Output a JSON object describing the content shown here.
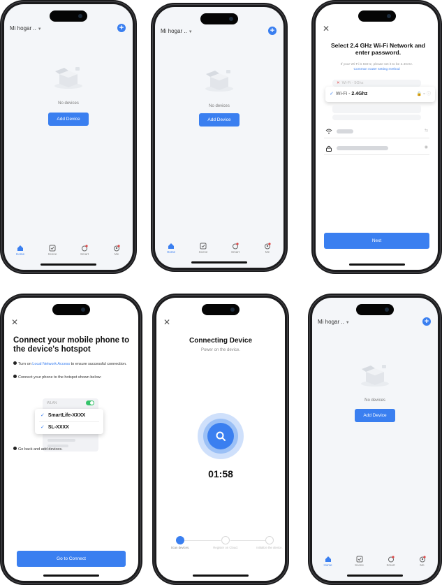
{
  "colors": {
    "accent": "#3a7ff0",
    "toggle_on": "#35c36a",
    "error": "#e04848"
  },
  "home_screen": {
    "home_name": "Mi hogar ..",
    "empty_text": "No devices",
    "add_device_label": "Add Device",
    "tabs": [
      {
        "label": "Home",
        "icon": "home-icon"
      },
      {
        "label": "Scene",
        "icon": "scene-icon"
      },
      {
        "label": "Smart",
        "icon": "smart-icon"
      },
      {
        "label": "Me",
        "icon": "me-icon"
      }
    ]
  },
  "wifi_screen": {
    "title": "Select 2.4 GHz Wi-Fi Network and enter password.",
    "subtitle": "If your Wi-Fi is 5GHz, please set it to be 2.4GHz.",
    "link_text": "Common router setting method",
    "network_5g": "Wi-Fi - 5Ghz",
    "network_24g_prefix": "Wi-Fi - ",
    "network_24g_band": "2.4Ghz",
    "next_label": "Next"
  },
  "hotspot_screen": {
    "title": "Connect your mobile phone to the device's hotspot",
    "step1_prefix": "Turn on ",
    "step1_link": "Local Network Access",
    "step1_suffix": " to ensure successful connection.",
    "step2": "Connect your phone to the hotspot shown below:",
    "wlan_label": "WLAN",
    "ssids": [
      "SmartLife-XXXX",
      "SL-XXXX"
    ],
    "step3": "Go back and add devices.",
    "go_label": "Go to Connect"
  },
  "connecting_screen": {
    "title": "Connecting Device",
    "subtitle": "Power on the device.",
    "timer": "01:58",
    "steps": [
      {
        "label": "Scan devices."
      },
      {
        "label": "Register on Cloud."
      },
      {
        "label": "Initialize the device."
      }
    ]
  }
}
